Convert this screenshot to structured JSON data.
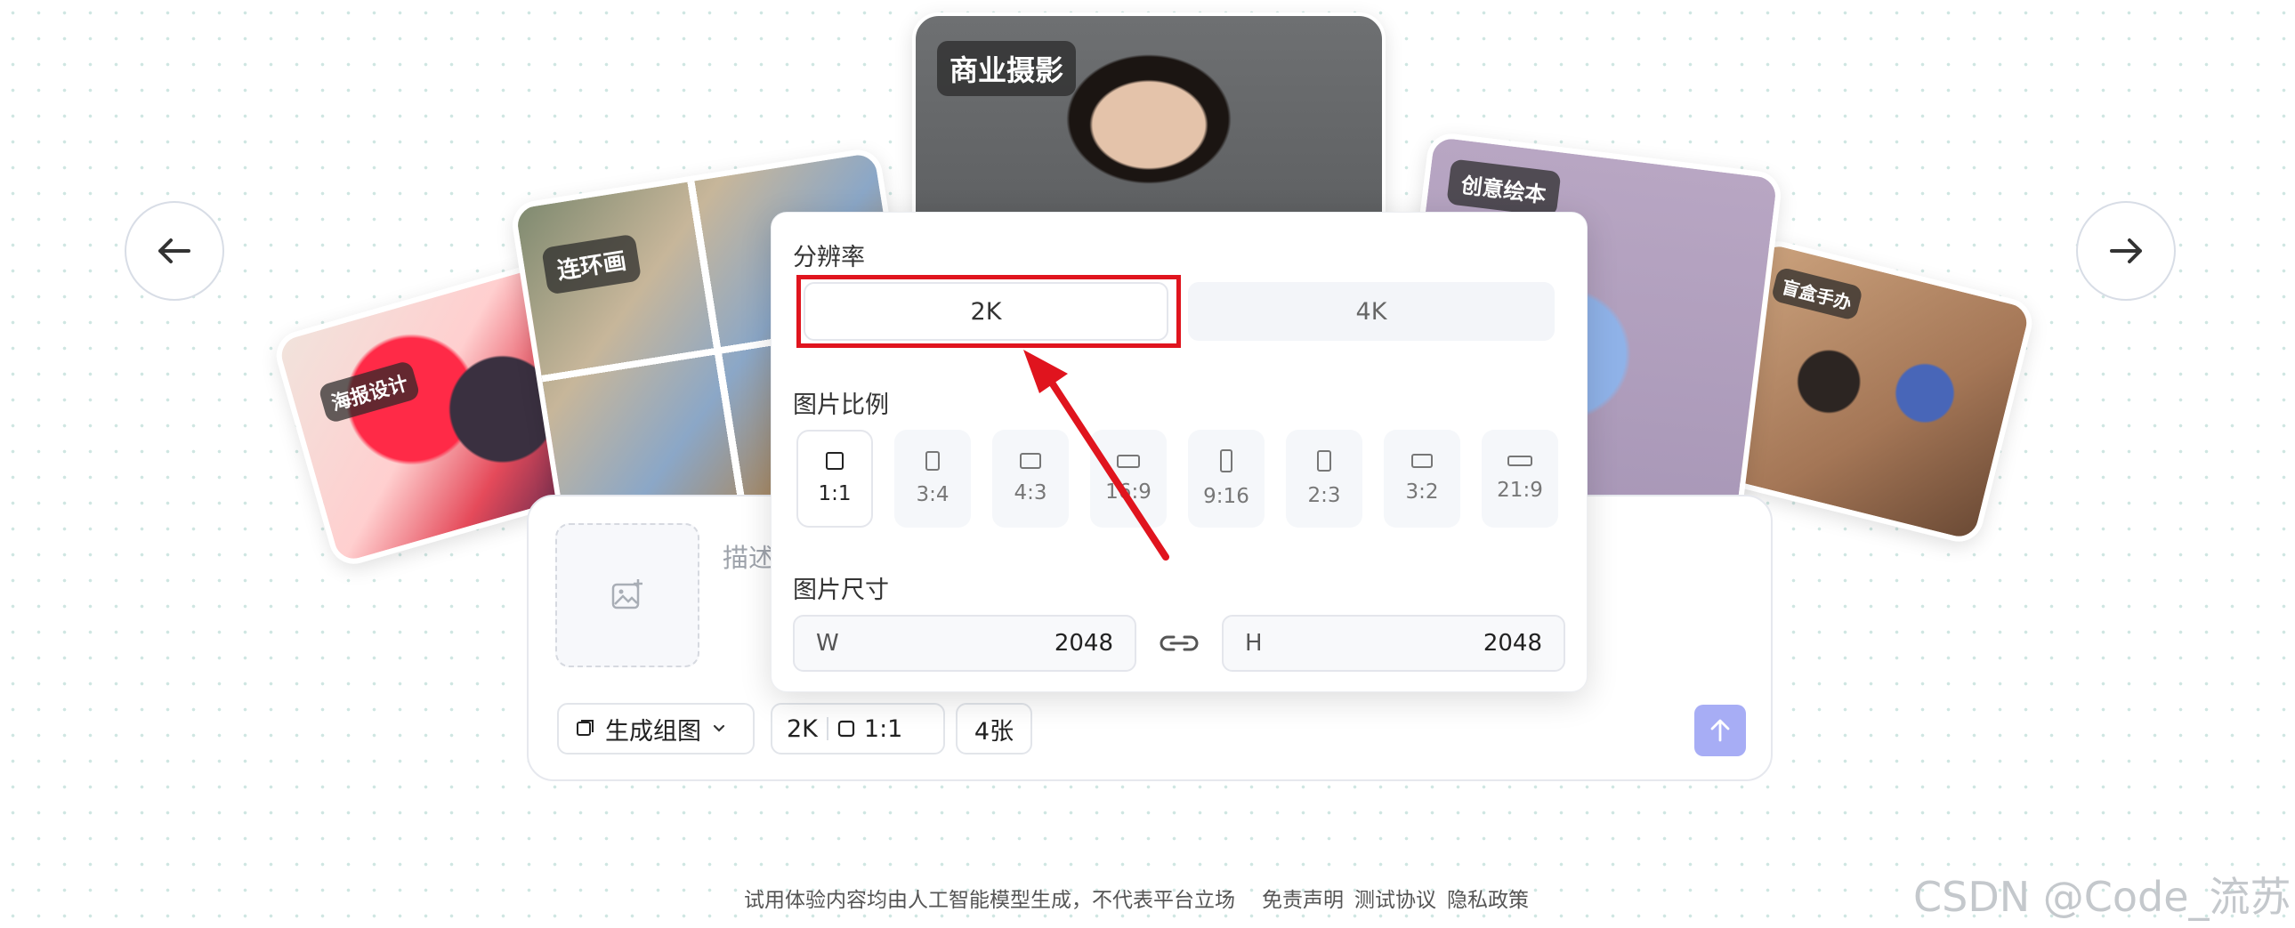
{
  "showcase": {
    "cards": [
      {
        "label": "海报设计"
      },
      {
        "label": "连环画"
      },
      {
        "label": "商业摄影"
      },
      {
        "label": "创意绘本"
      },
      {
        "label": "盲盒手办"
      }
    ]
  },
  "composer": {
    "placeholder": "描述",
    "mode_label": "生成组图",
    "resolution_value": "2K",
    "ratio_value": "1:1",
    "count_label": "4张"
  },
  "popover": {
    "resolution_title": "分辨率",
    "resolution_options": [
      "2K",
      "4K"
    ],
    "selected_resolution": "2K",
    "ratio_title": "图片比例",
    "ratio_options": [
      "1:1",
      "3:4",
      "4:3",
      "16:9",
      "9:16",
      "2:3",
      "3:2",
      "21:9"
    ],
    "selected_ratio": "1:1",
    "size_title": "图片尺寸",
    "width_label": "W",
    "width_value": "2048",
    "height_label": "H",
    "height_value": "2048"
  },
  "footer": {
    "disclaimer": "试用体验内容均由人工智能模型生成，不代表平台立场",
    "links": [
      "免责声明",
      "测试协议",
      "隐私政策"
    ]
  },
  "watermark": "CSDN @Code_流苏",
  "colors": {
    "accent": "#a7adf5",
    "annotation": "#e0141e"
  }
}
